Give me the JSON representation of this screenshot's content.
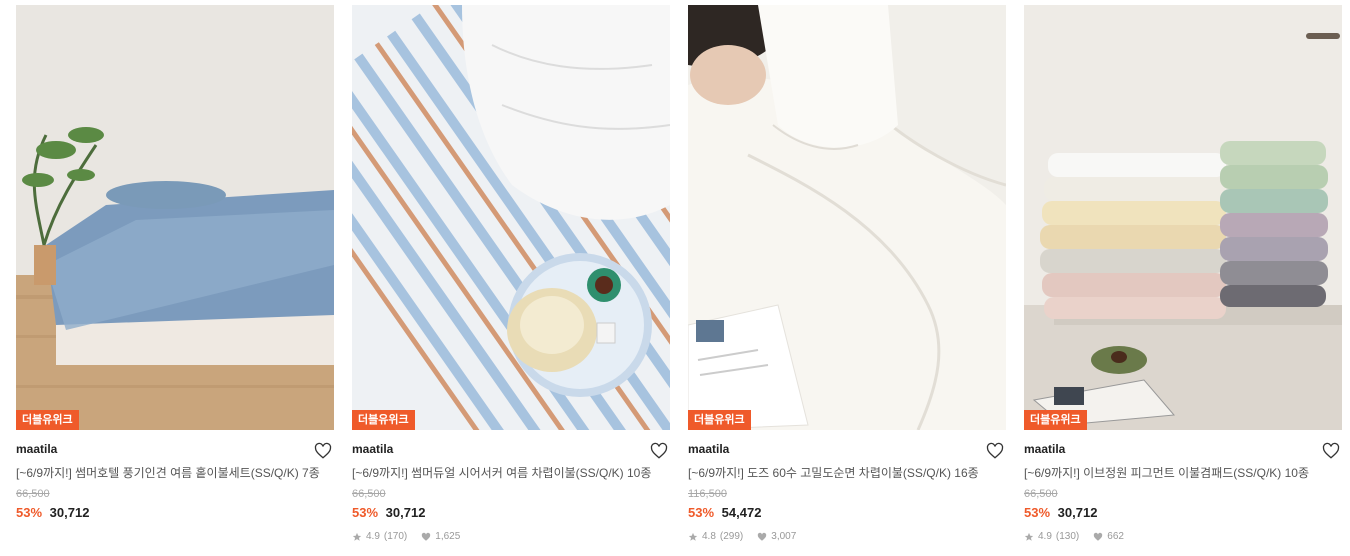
{
  "products": [
    {
      "badge": "더블유위크",
      "brand": "maatila",
      "title": "[~6/9까지!] 썸머호텔 풍기인견 여름 홑이불세트(SS/Q/K) 7종",
      "original_price": "66,500",
      "discount": "53%",
      "price": "30,712",
      "rating": "",
      "reviews": "",
      "likes": ""
    },
    {
      "badge": "더블유위크",
      "brand": "maatila",
      "title": "[~6/9까지!] 썸머듀얼 시어서커 여름 차렵이불(SS/Q/K) 10종",
      "original_price": "66,500",
      "discount": "53%",
      "price": "30,712",
      "rating": "4.9",
      "reviews": "(170)",
      "likes": "1,625"
    },
    {
      "badge": "더블유위크",
      "brand": "maatila",
      "title": "[~6/9까지!] 도즈 60수 고밀도순면 차렵이불(SS/Q/K) 16종",
      "original_price": "116,500",
      "discount": "53%",
      "price": "54,472",
      "rating": "4.8",
      "reviews": "(299)",
      "likes": "3,007"
    },
    {
      "badge": "더블유위크",
      "brand": "maatila",
      "title": "[~6/9까지!] 이브정원 피그먼트 이불겸패드(SS/Q/K) 10종",
      "original_price": "66,500",
      "discount": "53%",
      "price": "30,712",
      "rating": "4.9",
      "reviews": "(130)",
      "likes": "662"
    }
  ],
  "colors": {
    "accent": "#ef5a2a",
    "text": "#222222",
    "muted": "#a8a8a8"
  },
  "icons": {
    "heart": "heart-outline-icon",
    "star": "star-icon",
    "like": "heart-filled-icon"
  }
}
